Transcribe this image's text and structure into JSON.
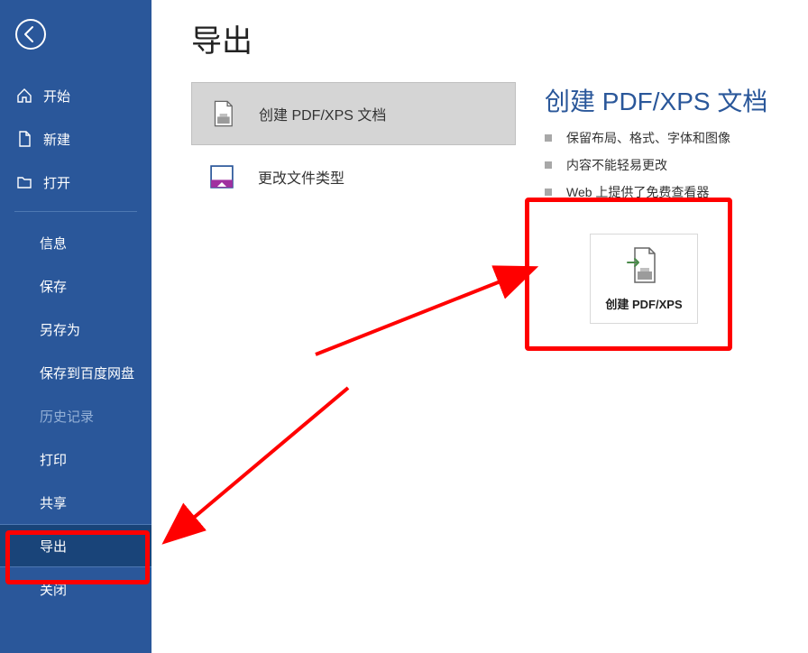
{
  "sidebar": {
    "items": [
      {
        "label": "开始",
        "icon": "home"
      },
      {
        "label": "新建",
        "icon": "new"
      },
      {
        "label": "打开",
        "icon": "open"
      },
      {
        "label": "信息"
      },
      {
        "label": "保存"
      },
      {
        "label": "另存为"
      },
      {
        "label": "保存到百度网盘"
      },
      {
        "label": "历史记录",
        "disabled": true
      },
      {
        "label": "打印"
      },
      {
        "label": "共享"
      },
      {
        "label": "导出",
        "selected": true
      },
      {
        "label": "关闭"
      }
    ]
  },
  "main": {
    "title": "导出",
    "options": [
      {
        "label": "创建 PDF/XPS 文档",
        "selected": true
      },
      {
        "label": "更改文件类型"
      }
    ],
    "detail": {
      "title": "创建 PDF/XPS 文档",
      "bullets": [
        "保留布局、格式、字体和图像",
        "内容不能轻易更改",
        "Web 上提供了免费查看器"
      ],
      "button_label": "创建 PDF/XPS"
    }
  }
}
